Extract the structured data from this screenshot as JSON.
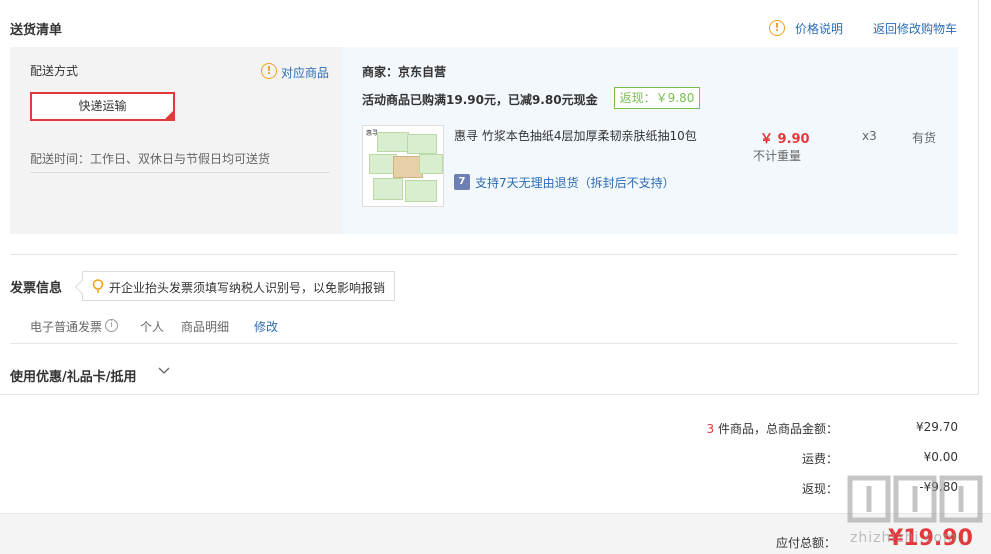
{
  "header": {
    "title": "送货清单",
    "price_note": "价格说明",
    "back_to_cart": "返回修改购物车"
  },
  "shipping": {
    "label": "配送方式",
    "match_goods": "对应商品",
    "method": "快递运输",
    "time": "配送时间：工作日、双休日与节假日均可送货"
  },
  "goods": {
    "merchant": "商家：京东自营",
    "promo": "活动商品已购满19.90元，已减9.80元现金",
    "cashback": "返现：￥9.80",
    "thumb_brand": "惠寻",
    "product_name": "惠寻 竹浆本色抽纸4层加厚柔韧亲肤纸抽10包",
    "return_badge": "7",
    "return_policy": "支持7天无理由退货（拆封后不支持）",
    "price": "￥ 9.90",
    "weight": "不计重量",
    "quantity": "x3",
    "stock": "有货"
  },
  "invoice": {
    "title": "发票信息",
    "tip": "开企业抬头发票须填写纳税人识别号，以免影响报销",
    "type": "电子普通发票",
    "header_type": "个人",
    "content": "商品明细",
    "edit": "修改"
  },
  "coupon": {
    "title": "使用优惠/礼品卡/抵用"
  },
  "summary": {
    "item_count": "3",
    "total_label": " 件商品，总商品金额：",
    "total_value": "¥29.70",
    "freight_label": "运费：",
    "freight_value": "¥0.00",
    "cashback_label": "返现：",
    "cashback_value": "-¥9.80",
    "payable_label": "应付总额：",
    "payable_value": "¥19.90"
  },
  "watermark": {
    "text": "zhizhizhi.com"
  },
  "colors": {
    "accent_red": "#e4393c",
    "link_blue": "#2c6cb3",
    "cashback_green": "#7abd54",
    "warn_orange": "#f0a020"
  }
}
